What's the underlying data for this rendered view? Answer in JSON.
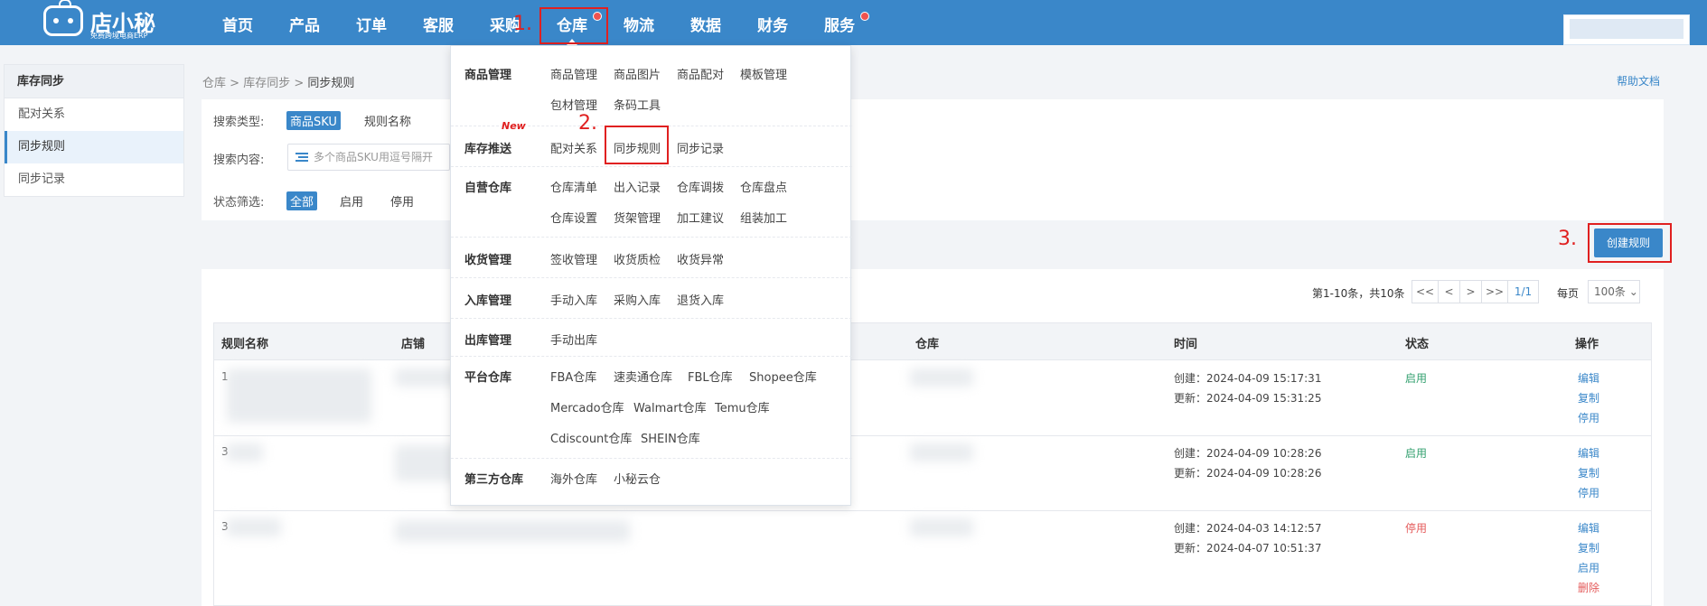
{
  "topbar": {
    "logo_name": "店小秘",
    "logo_sub": "免费跨境电商ERP",
    "nav": [
      {
        "label": "首页"
      },
      {
        "label": "产品"
      },
      {
        "label": "订单"
      },
      {
        "label": "客服"
      },
      {
        "label": "采购"
      },
      {
        "label": "仓库"
      },
      {
        "label": "物流"
      },
      {
        "label": "数据"
      },
      {
        "label": "财务"
      },
      {
        "label": "服务"
      }
    ],
    "active_nav": "仓库"
  },
  "annotations": {
    "step1": "1.",
    "step2": "2.",
    "step3": "3."
  },
  "dropdown": {
    "new_tag": "New",
    "sections": [
      {
        "title": "商品管理",
        "links": [
          "商品管理",
          "商品图片",
          "商品配对",
          "模板管理",
          "包材管理",
          "条码工具"
        ]
      },
      {
        "title": "库存推送",
        "links": [
          "配对关系",
          "同步规则",
          "同步记录"
        ]
      },
      {
        "title": "自营仓库",
        "links": [
          "仓库清单",
          "出入记录",
          "仓库调拨",
          "仓库盘点",
          "仓库设置",
          "货架管理",
          "加工建议",
          "组装加工"
        ]
      },
      {
        "title": "收货管理",
        "links": [
          "签收管理",
          "收货质检",
          "收货异常"
        ]
      },
      {
        "title": "入库管理",
        "links": [
          "手动入库",
          "采购入库",
          "退货入库"
        ]
      },
      {
        "title": "出库管理",
        "links": [
          "手动出库"
        ]
      },
      {
        "title": "平台仓库",
        "links": [
          "FBA仓库",
          "速卖通仓库",
          "FBL仓库",
          "Shopee仓库",
          "Mercado仓库",
          "Walmart仓库",
          "Temu仓库",
          "Cdiscount仓库",
          "SHEIN仓库"
        ]
      },
      {
        "title": "第三方仓库",
        "links": [
          "海外仓库",
          "小秘云仓"
        ]
      }
    ]
  },
  "sidebar": {
    "title": "库存同步",
    "items": [
      {
        "label": "配对关系"
      },
      {
        "label": "同步规则"
      },
      {
        "label": "同步记录"
      }
    ],
    "active": "同步规则"
  },
  "breadcrumb": {
    "a": "仓库",
    "b": "库存同步",
    "c": "同步规则",
    "sep": " > "
  },
  "help_link": "帮助文档",
  "filter": {
    "search_type_label": "搜索类型:",
    "search_type_options": [
      "商品SKU",
      "规则名称"
    ],
    "search_content_label": "搜索内容:",
    "search_placeholder": "多个商品SKU用逗号隔开",
    "status_label": "状态筛选:",
    "status_options": [
      "全部",
      "启用",
      "停用"
    ]
  },
  "create_button": "创建规则",
  "pager": {
    "summary": "第1-10条，共10条",
    "first": "<<",
    "prev": "<",
    "next": ">",
    "last": ">>",
    "page": "1/1",
    "per_page_label": "每页",
    "per_page_value": "100条"
  },
  "table": {
    "headers": [
      "规则名称",
      "店铺",
      "仓库",
      "时间",
      "状态",
      "操作"
    ],
    "rows": [
      {
        "name_prefix": "1",
        "created": "创建：2024-04-09 15:17:31",
        "updated": "更新：2024-04-09 15:31:25",
        "status": "启用",
        "actions": [
          "编辑",
          "复制",
          "停用"
        ]
      },
      {
        "name_prefix": "3",
        "created": "创建：2024-04-09 10:28:26",
        "updated": "更新：2024-04-09 10:28:26",
        "status": "启用",
        "actions": [
          "编辑",
          "复制",
          "停用"
        ]
      },
      {
        "name_prefix": "3",
        "created": "创建：2024-04-03 14:12:57",
        "updated": "更新：2024-04-07 10:51:37",
        "status": "停用",
        "actions": [
          "编辑",
          "复制",
          "启用",
          "删除"
        ]
      }
    ]
  },
  "colors": {
    "primary": "#3a87c9",
    "annotation": "#e02020",
    "enabled": "#33a06f",
    "disabled": "#e45a5a"
  }
}
